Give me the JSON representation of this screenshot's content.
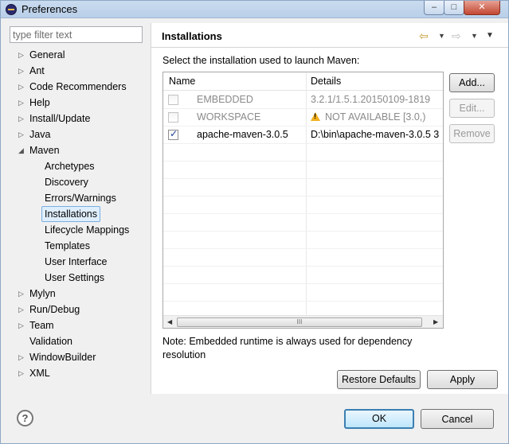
{
  "window": {
    "title": "Preferences",
    "controls": {
      "minimize": "–",
      "maximize": "□",
      "close": "✕"
    }
  },
  "filter": {
    "placeholder": "type filter text",
    "value": ""
  },
  "tree": [
    {
      "label": "General",
      "arrow": "▷",
      "selected": false
    },
    {
      "label": "Ant",
      "arrow": "▷",
      "selected": false
    },
    {
      "label": "Code Recommenders",
      "arrow": "▷",
      "selected": false
    },
    {
      "label": "Help",
      "arrow": "▷",
      "selected": false
    },
    {
      "label": "Install/Update",
      "arrow": "▷",
      "selected": false
    },
    {
      "label": "Java",
      "arrow": "▷",
      "selected": false
    },
    {
      "label": "Maven",
      "arrow": "◢",
      "selected": false
    },
    {
      "label": "Archetypes",
      "arrow": "",
      "selected": false
    },
    {
      "label": "Discovery",
      "arrow": "",
      "selected": false
    },
    {
      "label": "Errors/Warnings",
      "arrow": "",
      "selected": false
    },
    {
      "label": "Installations",
      "arrow": "",
      "selected": true
    },
    {
      "label": "Lifecycle Mappings",
      "arrow": "",
      "selected": false
    },
    {
      "label": "Templates",
      "arrow": "",
      "selected": false
    },
    {
      "label": "User Interface",
      "arrow": "",
      "selected": false
    },
    {
      "label": "User Settings",
      "arrow": "",
      "selected": false
    },
    {
      "label": "Mylyn",
      "arrow": "▷",
      "selected": false
    },
    {
      "label": "Run/Debug",
      "arrow": "▷",
      "selected": false
    },
    {
      "label": "Team",
      "arrow": "▷",
      "selected": false
    },
    {
      "label": "Validation",
      "arrow": "",
      "selected": false
    },
    {
      "label": "WindowBuilder",
      "arrow": "▷",
      "selected": false
    },
    {
      "label": "XML",
      "arrow": "▷",
      "selected": false
    }
  ],
  "panel": {
    "title": "Installations",
    "description": "Select the installation used to launch Maven:",
    "table": {
      "columns": [
        "Name",
        "Details"
      ],
      "rows": [
        {
          "name": "EMBEDDED",
          "details": "3.2.1/1.5.1.20150109-1819",
          "checked": false,
          "enabled": false,
          "warning": false
        },
        {
          "name": "WORKSPACE",
          "details": "NOT AVAILABLE [3.0,)",
          "checked": false,
          "enabled": false,
          "warning": true
        },
        {
          "name": "apache-maven-3.0.5",
          "details": "D:\\bin\\apache-maven-3.0.5 3",
          "checked": true,
          "enabled": true,
          "warning": false
        }
      ],
      "scroll_thumb": "III"
    },
    "buttons": {
      "add": "Add...",
      "edit": "Edit...",
      "remove": "Remove"
    },
    "note": "Note: Embedded runtime is always used for dependency resolution",
    "restore_defaults": "Restore Defaults",
    "apply": "Apply"
  },
  "footer": {
    "help": "?",
    "ok": "OK",
    "cancel": "Cancel"
  },
  "colors": {
    "selection": "#dfeefc",
    "selection_border": "#7aaee0",
    "warning": "#f2b01e",
    "default_button_border": "#3c7fb1"
  }
}
